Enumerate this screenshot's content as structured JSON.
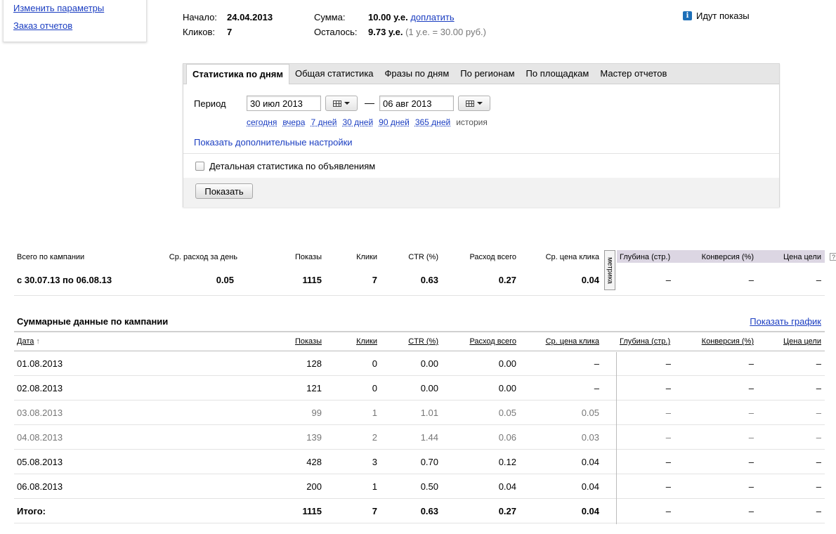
{
  "left_box": {
    "change_params": "Изменить параметры",
    "order_reports": "Заказ отчетов"
  },
  "campaign": {
    "start_label": "Начало:",
    "start_value": "24.04.2013",
    "clicks_label": "Кликов:",
    "clicks_value": "7",
    "sum_label": "Сумма:",
    "sum_value": "10.00 у.е.",
    "topup_link": "доплатить",
    "remaining_label": "Осталось:",
    "remaining_value": "9.73 у.е.",
    "rate_note": "(1 у.е. = 30.00 руб.)",
    "status": "Идут показы"
  },
  "tabs": [
    {
      "label": "Статистика по дням",
      "active": true
    },
    {
      "label": "Общая статистика",
      "active": false
    },
    {
      "label": "Фразы по дням",
      "active": false
    },
    {
      "label": "По регионам",
      "active": false
    },
    {
      "label": "По площадкам",
      "active": false
    },
    {
      "label": "Мастер отчетов",
      "active": false
    }
  ],
  "period": {
    "label": "Период",
    "from": "30 июл 2013",
    "to": "06 авг 2013",
    "dash": "—",
    "quick": [
      "сегодня",
      "вчера",
      "7 дней",
      "30 дней",
      "90 дней",
      "365 дней"
    ],
    "history": "история"
  },
  "more_settings": "Показать дополнительные настройки",
  "detail_checkbox": {
    "label": "Детальная статистика по объявлениям",
    "checked": false
  },
  "show_button": "Показать",
  "summary": {
    "headers": [
      "Всего по кампании",
      "Ср. расход за день",
      "Показы",
      "Клики",
      "CTR (%)",
      "Расход всего",
      "Ср. цена клика",
      "Глубина (стр.)",
      "Конверсия (%)",
      "Цена цели"
    ],
    "row": [
      "с 30.07.13 по 06.08.13",
      "0.05",
      "1115",
      "7",
      "0.63",
      "0.27",
      "0.04",
      "–",
      "–",
      "–"
    ],
    "metrika_label": "метрика",
    "help": "?"
  },
  "daily": {
    "title": "Суммарные данные по кампании",
    "graph_link": "Показать график",
    "headers": [
      "Дата",
      "Показы",
      "Клики",
      "CTR (%)",
      "Расход всего",
      "Ср. цена клика",
      "Глубина (стр.)",
      "Конверсия (%)",
      "Цена цели"
    ],
    "sort_arrow": "↑",
    "rows": [
      {
        "date": "01.08.2013",
        "shows": "128",
        "clicks": "0",
        "ctr": "0.00",
        "spend": "0.00",
        "cpc": "–",
        "depth": "–",
        "conv": "–",
        "goal": "–",
        "muted": false
      },
      {
        "date": "02.08.2013",
        "shows": "121",
        "clicks": "0",
        "ctr": "0.00",
        "spend": "0.00",
        "cpc": "–",
        "depth": "–",
        "conv": "–",
        "goal": "–",
        "muted": false
      },
      {
        "date": "03.08.2013",
        "shows": "99",
        "clicks": "1",
        "ctr": "1.01",
        "spend": "0.05",
        "cpc": "0.05",
        "depth": "–",
        "conv": "–",
        "goal": "–",
        "muted": true
      },
      {
        "date": "04.08.2013",
        "shows": "139",
        "clicks": "2",
        "ctr": "1.44",
        "spend": "0.06",
        "cpc": "0.03",
        "depth": "–",
        "conv": "–",
        "goal": "–",
        "muted": true
      },
      {
        "date": "05.08.2013",
        "shows": "428",
        "clicks": "3",
        "ctr": "0.70",
        "spend": "0.12",
        "cpc": "0.04",
        "depth": "–",
        "conv": "–",
        "goal": "–",
        "muted": false
      },
      {
        "date": "06.08.2013",
        "shows": "200",
        "clicks": "1",
        "ctr": "0.50",
        "spend": "0.04",
        "cpc": "0.04",
        "depth": "–",
        "conv": "–",
        "goal": "–",
        "muted": false
      }
    ],
    "total": {
      "date": "Итого:",
      "shows": "1115",
      "clicks": "7",
      "ctr": "0.63",
      "spend": "0.27",
      "cpc": "0.04",
      "depth": "–",
      "conv": "–",
      "goal": "–"
    }
  }
}
